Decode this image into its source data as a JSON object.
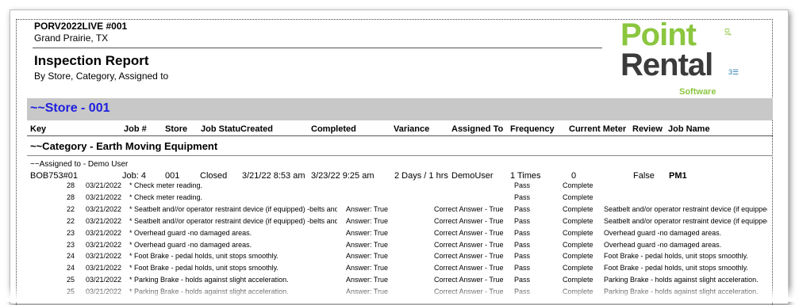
{
  "header": {
    "company": "PORV2022LIVE #001",
    "city": "Grand Prairie, TX",
    "title": "Inspection Report",
    "subtitle": "By Store, Category, Assigned to"
  },
  "logo": {
    "line1": "Point",
    "of": "of",
    "line2": "Rental",
    "software": "Software",
    "mark": "3☰"
  },
  "store": {
    "label": "~~Store - 001"
  },
  "columns": [
    "Key",
    "Job #",
    "Store",
    "Job Statu",
    "Created",
    "Completed",
    "Variance",
    "Assigned To",
    "Frequency",
    "Current Meter",
    "Review",
    "Job Name"
  ],
  "category": "~~Category - Earth Moving Equipment",
  "assigned_to": "~~Assigned to - Demo User",
  "job": {
    "key": "BOB753#01",
    "job_no": "Job: 4",
    "store": "001",
    "status": "Closed",
    "created": "3/21/22  8:53 am",
    "completed": "3/23/22  9:25 am",
    "variance": "2 Days /  1 hrs",
    "assigned": "DemoUser",
    "frequency": "1 Times",
    "meter": "0",
    "review": "False",
    "name": "PM1"
  },
  "rows": [
    {
      "id": "28",
      "date": "03/21/2022",
      "item": "*  Check meter reading.",
      "answer": "",
      "correct": "",
      "result": "Pass",
      "status": "Complete",
      "desc": ""
    },
    {
      "id": "28",
      "date": "03/21/2022",
      "item": "*  Check meter reading.",
      "answer": "",
      "correct": "",
      "result": "Pass",
      "status": "Complete",
      "desc": ""
    },
    {
      "id": "22",
      "date": "03/21/2022",
      "item": "* Seatbelt and//or operator restraint device (if equipped) -belts and n",
      "answer": "Answer: True",
      "correct": "Correct Answer - True",
      "result": "Pass",
      "status": "Complete",
      "desc": "Seatbelt and/or operator restraint device (if equipped)"
    },
    {
      "id": "22",
      "date": "03/21/2022",
      "item": "* Seatbelt and//or operator restraint device (if equipped) -belts and n",
      "answer": "Answer: True",
      "correct": "Correct Answer - True",
      "result": "Pass",
      "status": "Complete",
      "desc": "Seatbelt and/or operator restraint device (if equipped)"
    },
    {
      "id": "23",
      "date": "03/21/2022",
      "item": "* Overhead guard -no damaged areas.",
      "answer": "Answer: True",
      "correct": "Correct Answer - True",
      "result": "Pass",
      "status": "Complete",
      "desc": "Overhead guard -no damaged areas."
    },
    {
      "id": "23",
      "date": "03/21/2022",
      "item": "* Overhead guard -no damaged areas.",
      "answer": "Answer: True",
      "correct": "Correct Answer - True",
      "result": "Pass",
      "status": "Complete",
      "desc": "Overhead guard -no damaged areas."
    },
    {
      "id": "24",
      "date": "03/21/2022",
      "item": "* Foot Brake - pedal holds, unit stops smoothly.",
      "answer": "Answer: True",
      "correct": "Correct Answer - True",
      "result": "Pass",
      "status": "Complete",
      "desc": "Foot Brake - pedal holds, unit stops smoothly."
    },
    {
      "id": "24",
      "date": "03/21/2022",
      "item": "* Foot Brake - pedal holds, unit stops smoothly.",
      "answer": "Answer: True",
      "correct": "Correct Answer - True",
      "result": "Pass",
      "status": "Complete",
      "desc": "Foot Brake - pedal holds, unit stops smoothly."
    },
    {
      "id": "25",
      "date": "03/21/2022",
      "item": "* Parking Brake - holds against slight acceleration.",
      "answer": "Answer: True",
      "correct": "Correct Answer - True",
      "result": "Pass",
      "status": "Complete",
      "desc": "Parking Brake - holds against slight acceleration."
    },
    {
      "id": "25",
      "date": "03/21/2022",
      "item": "* Parking Brake - holds against slight acceleration.",
      "answer": "Answer: True",
      "correct": "Correct Answer - True",
      "result": "Pass",
      "status": "Complete",
      "desc": "Parking Brake - holds against slight acceleration."
    }
  ]
}
